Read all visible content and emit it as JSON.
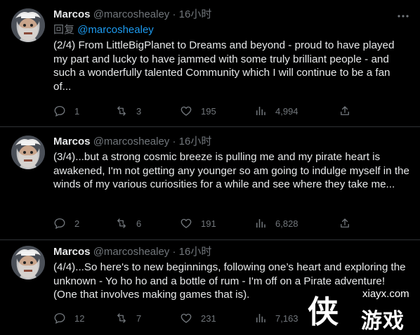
{
  "tweets": [
    {
      "name": "Marcos",
      "handle": "@marcoshealey",
      "dot": "·",
      "time": "16小时",
      "reply_label": "回复",
      "reply_mention": "@marcoshealey",
      "text": "(2/4) From LittleBigPlanet to Dreams and beyond - proud to have played my part and lucky to have jammed with some truly brilliant people - and such a wonderfully talented Community which I will continue to be a fan of...",
      "replies": "1",
      "retweets": "3",
      "likes": "195",
      "views": "4,994"
    },
    {
      "name": "Marcos",
      "handle": "@marcoshealey",
      "dot": "·",
      "time": "16小时",
      "text": "(3/4)...but a strong cosmic breeze is pulling me and my pirate heart is awakened, I'm not getting any younger so am going to indulge myself in the winds of my various curiosities for a while and see where they take me...",
      "replies": "2",
      "retweets": "6",
      "likes": "191",
      "views": "6,828"
    },
    {
      "name": "Marcos",
      "handle": "@marcoshealey",
      "dot": "·",
      "time": "16小时",
      "text": "(4/4)...So here's to new beginnings, following one’s heart and exploring the unknown - Yo ho ho and a bottle of rum - I'm off on a Pirate adventure! (One that involves making games that is).",
      "replies": "12",
      "retweets": "7",
      "likes": "231",
      "views": "7,163"
    }
  ],
  "watermark": {
    "site": "xiayx.com",
    "glyph": "侠",
    "name": "游戏"
  },
  "icons": {
    "more": "more-icon",
    "reply": "reply-icon",
    "retweet": "retweet-icon",
    "like": "like-icon",
    "views": "views-icon",
    "share": "share-icon"
  },
  "colors": {
    "background": "#000000",
    "text": "#e7e9ea",
    "muted": "#71767b",
    "link": "#1d9bf0",
    "divider": "#2f3336"
  }
}
